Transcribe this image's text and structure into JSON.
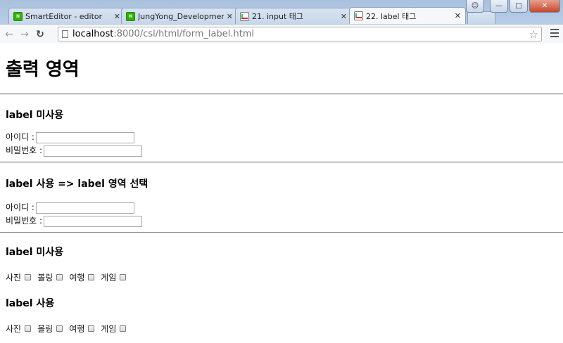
{
  "browser": {
    "tabs": [
      {
        "label": "SmartEditor - editor",
        "icon": "naver-icon",
        "active": false
      },
      {
        "label": "JungYong_Development",
        "icon": "naver-icon",
        "active": false
      },
      {
        "label": "21. input 태그",
        "icon": "document-icon",
        "active": false
      },
      {
        "label": "22. label 태그",
        "icon": "document-icon",
        "active": true
      }
    ],
    "url_host": "localhost",
    "url_path": ":8000/csl/html/form_label.html"
  },
  "page": {
    "title": "출력 영역",
    "section1": {
      "heading": "label 미사용",
      "id_label": "아이디 :",
      "pw_label": "비밀번호 :"
    },
    "section2": {
      "heading": "label 사용 => label 영역 선택",
      "id_label": "아이디 :",
      "pw_label": "비밀번호 :"
    },
    "section3": {
      "heading": "label 미사용",
      "options": [
        "사진",
        "볼링",
        "여행",
        "게임"
      ]
    },
    "section4": {
      "heading": "label 사용",
      "options": [
        "사진",
        "볼링",
        "여행",
        "게임"
      ]
    }
  }
}
